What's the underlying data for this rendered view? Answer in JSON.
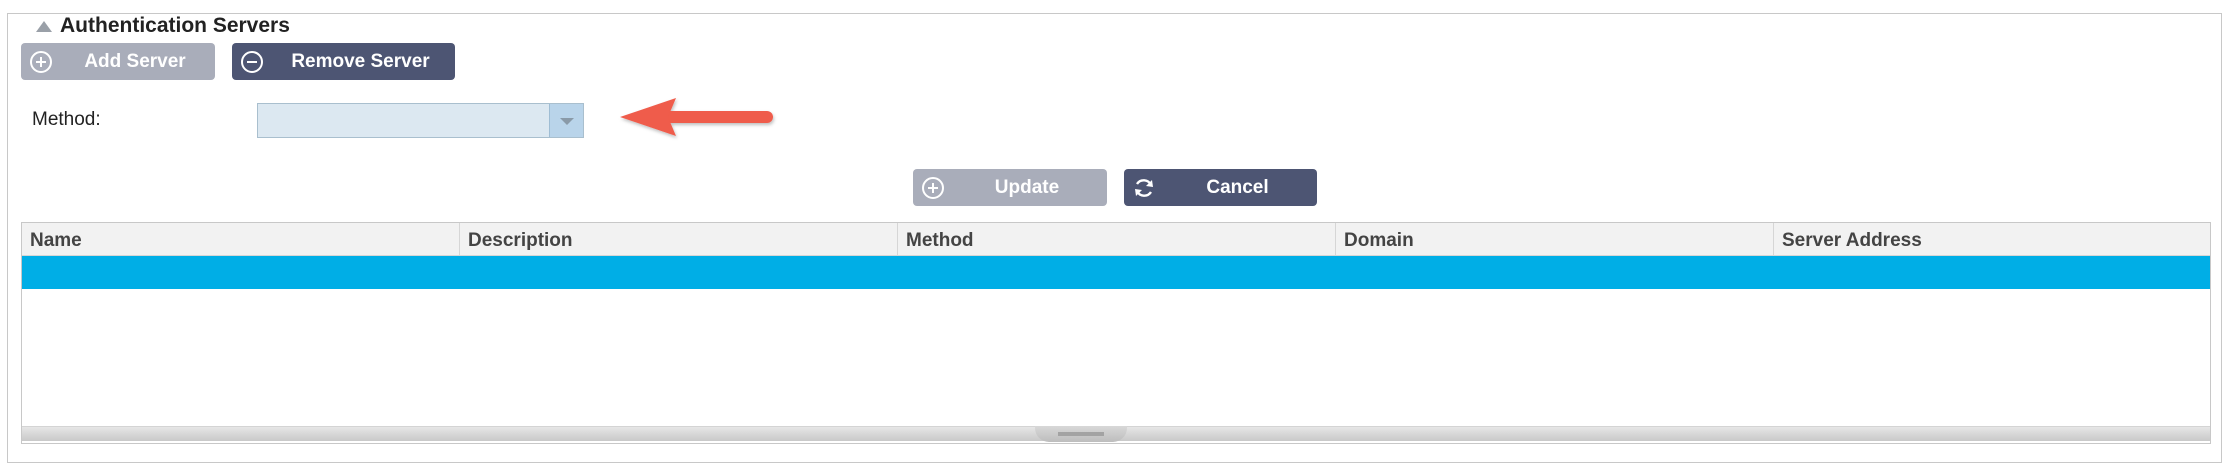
{
  "panel": {
    "title": "Authentication Servers"
  },
  "toolbar": {
    "add_label": "Add Server",
    "remove_label": "Remove Server"
  },
  "form": {
    "method_label": "Method:",
    "method_value": ""
  },
  "actions": {
    "update_label": "Update",
    "cancel_label": "Cancel"
  },
  "table": {
    "columns": [
      "Name",
      "Description",
      "Method",
      "Domain",
      "Server Address"
    ],
    "rows": [
      [
        "",
        "",
        "",
        "",
        ""
      ]
    ],
    "selected_row": 0
  },
  "colors": {
    "button_light": "#a9adba",
    "button_dark": "#4d5573",
    "selected_row": "#00aee6",
    "annotation_arrow": "#ef5b4b"
  },
  "icons": {
    "collapse": "triangle-up-icon",
    "add": "plus-circle-icon",
    "remove": "minus-circle-icon",
    "update": "plus-circle-icon",
    "cancel": "refresh-icon",
    "dropdown": "chevron-down-icon",
    "annotation": "arrow-left-icon"
  }
}
